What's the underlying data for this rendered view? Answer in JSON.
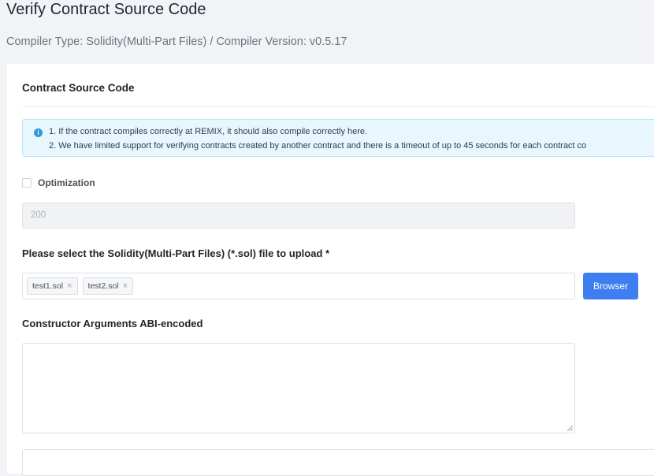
{
  "header": {
    "title": "Verify Contract Source Code",
    "subtitle": "Compiler Type: Solidity(Multi-Part Files) / Compiler Version: v0.5.17"
  },
  "card": {
    "title": "Contract Source Code",
    "info": {
      "icon": "info-icon",
      "line1": "1. If the contract compiles correctly at REMIX, it should also compile correctly here.",
      "line2": "2. We have limited support for verifying contracts created by another contract and there is a timeout of up to 45 seconds for each contract co"
    },
    "optimization": {
      "label": "Optimization",
      "checked": false
    },
    "runs_input": {
      "value": "200"
    },
    "upload": {
      "label": "Please select the Solidity(Multi-Part Files) (*.sol) file to upload *",
      "files": [
        {
          "name": "test1.sol",
          "close": "×"
        },
        {
          "name": "test2.sol",
          "close": "×"
        }
      ],
      "button_label": "Browser"
    },
    "constructor_args": {
      "label": "Constructor Arguments ABI-encoded",
      "value": ""
    }
  },
  "colors": {
    "accent": "#3e7ef0",
    "info_bg": "#e8f7fd",
    "info_icon": "#3498db"
  }
}
